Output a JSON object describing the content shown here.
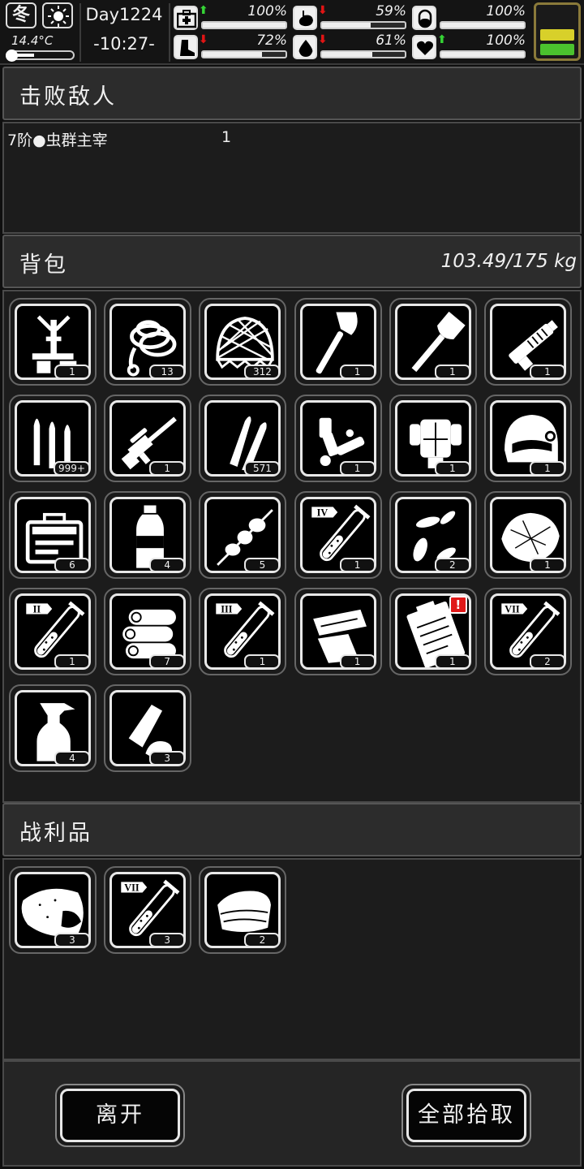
{
  "status": {
    "season": "冬",
    "weather_icon": "sun-icon",
    "temperature": "14.4°C",
    "thermometer_level": 0.35,
    "day": "Day1224",
    "time": "-10:27-",
    "stats": [
      {
        "name": "health",
        "icon": "medkit-icon",
        "trend": "up",
        "percent": "100%",
        "level": 1.0
      },
      {
        "name": "hunger",
        "icon": "stomach-icon",
        "trend": "down",
        "percent": "59%",
        "level": 0.59
      },
      {
        "name": "medicine",
        "icon": "pill-icon",
        "trend": "none",
        "percent": "100%",
        "level": 1.0
      },
      {
        "name": "stamina",
        "icon": "foot-icon",
        "trend": "down",
        "percent": "72%",
        "level": 0.72
      },
      {
        "name": "thirst",
        "icon": "water-drop-icon",
        "trend": "down",
        "percent": "61%",
        "level": 0.61
      },
      {
        "name": "mood",
        "icon": "heart-icon",
        "trend": "up",
        "percent": "100%",
        "level": 1.0
      }
    ],
    "energy_level": 0.5,
    "colors": {
      "energy_yellow": "#d8d02a",
      "energy_green": "#4bc22e",
      "up_arrow": "#35d435",
      "down_arrow": "#e21414"
    }
  },
  "defeated": {
    "title": "击败敌人",
    "enemies": [
      {
        "name": "7阶●虫群主宰",
        "count": "1"
      }
    ]
  },
  "backpack": {
    "title": "背包",
    "weight": "103.49/175 kg",
    "items": [
      {
        "icon": "workbench-icon",
        "count": "1"
      },
      {
        "icon": "rope-icon",
        "count": "13"
      },
      {
        "icon": "net-icon",
        "count": "312"
      },
      {
        "icon": "axe-icon",
        "count": "1"
      },
      {
        "icon": "shovel-icon",
        "count": "1"
      },
      {
        "icon": "minigun-icon",
        "count": "1"
      },
      {
        "icon": "rifle-ammo-icon",
        "count": "999+"
      },
      {
        "icon": "sniper-rifle-icon",
        "count": "1"
      },
      {
        "icon": "bullets-icon",
        "count": "571"
      },
      {
        "icon": "mech-arm-icon",
        "count": "1"
      },
      {
        "icon": "power-armor-icon",
        "count": "1"
      },
      {
        "icon": "helmet-icon",
        "count": "1"
      },
      {
        "icon": "toolbox-icon",
        "count": "6"
      },
      {
        "icon": "water-bottle-icon",
        "count": "4"
      },
      {
        "icon": "skewer-icon",
        "count": "5"
      },
      {
        "icon": "test-tube-iv-icon",
        "tier": "IV",
        "count": "1"
      },
      {
        "icon": "seeds-icon",
        "count": "2"
      },
      {
        "icon": "fiber-icon",
        "count": "1"
      },
      {
        "icon": "test-tube-ii-icon",
        "tier": "II",
        "count": "1"
      },
      {
        "icon": "logs-icon",
        "count": "7"
      },
      {
        "icon": "test-tube-iii-icon",
        "tier": "III",
        "count": "1"
      },
      {
        "icon": "scrap-metal-icon",
        "count": "1"
      },
      {
        "icon": "clipboard-icon",
        "count": "1",
        "alert": "!"
      },
      {
        "icon": "test-tube-vii-icon",
        "tier": "VII",
        "count": "2"
      },
      {
        "icon": "spray-bottle-icon",
        "count": "4"
      },
      {
        "icon": "plastic-trash-icon",
        "count": "3"
      }
    ]
  },
  "loot": {
    "title": "战利品",
    "items": [
      {
        "icon": "raw-meat-icon",
        "count": "3"
      },
      {
        "icon": "test-tube-vii-icon",
        "tier": "VII",
        "count": "3"
      },
      {
        "icon": "cloth-icon",
        "count": "2"
      }
    ]
  },
  "buttons": {
    "leave": "离开",
    "take_all": "全部拾取"
  }
}
